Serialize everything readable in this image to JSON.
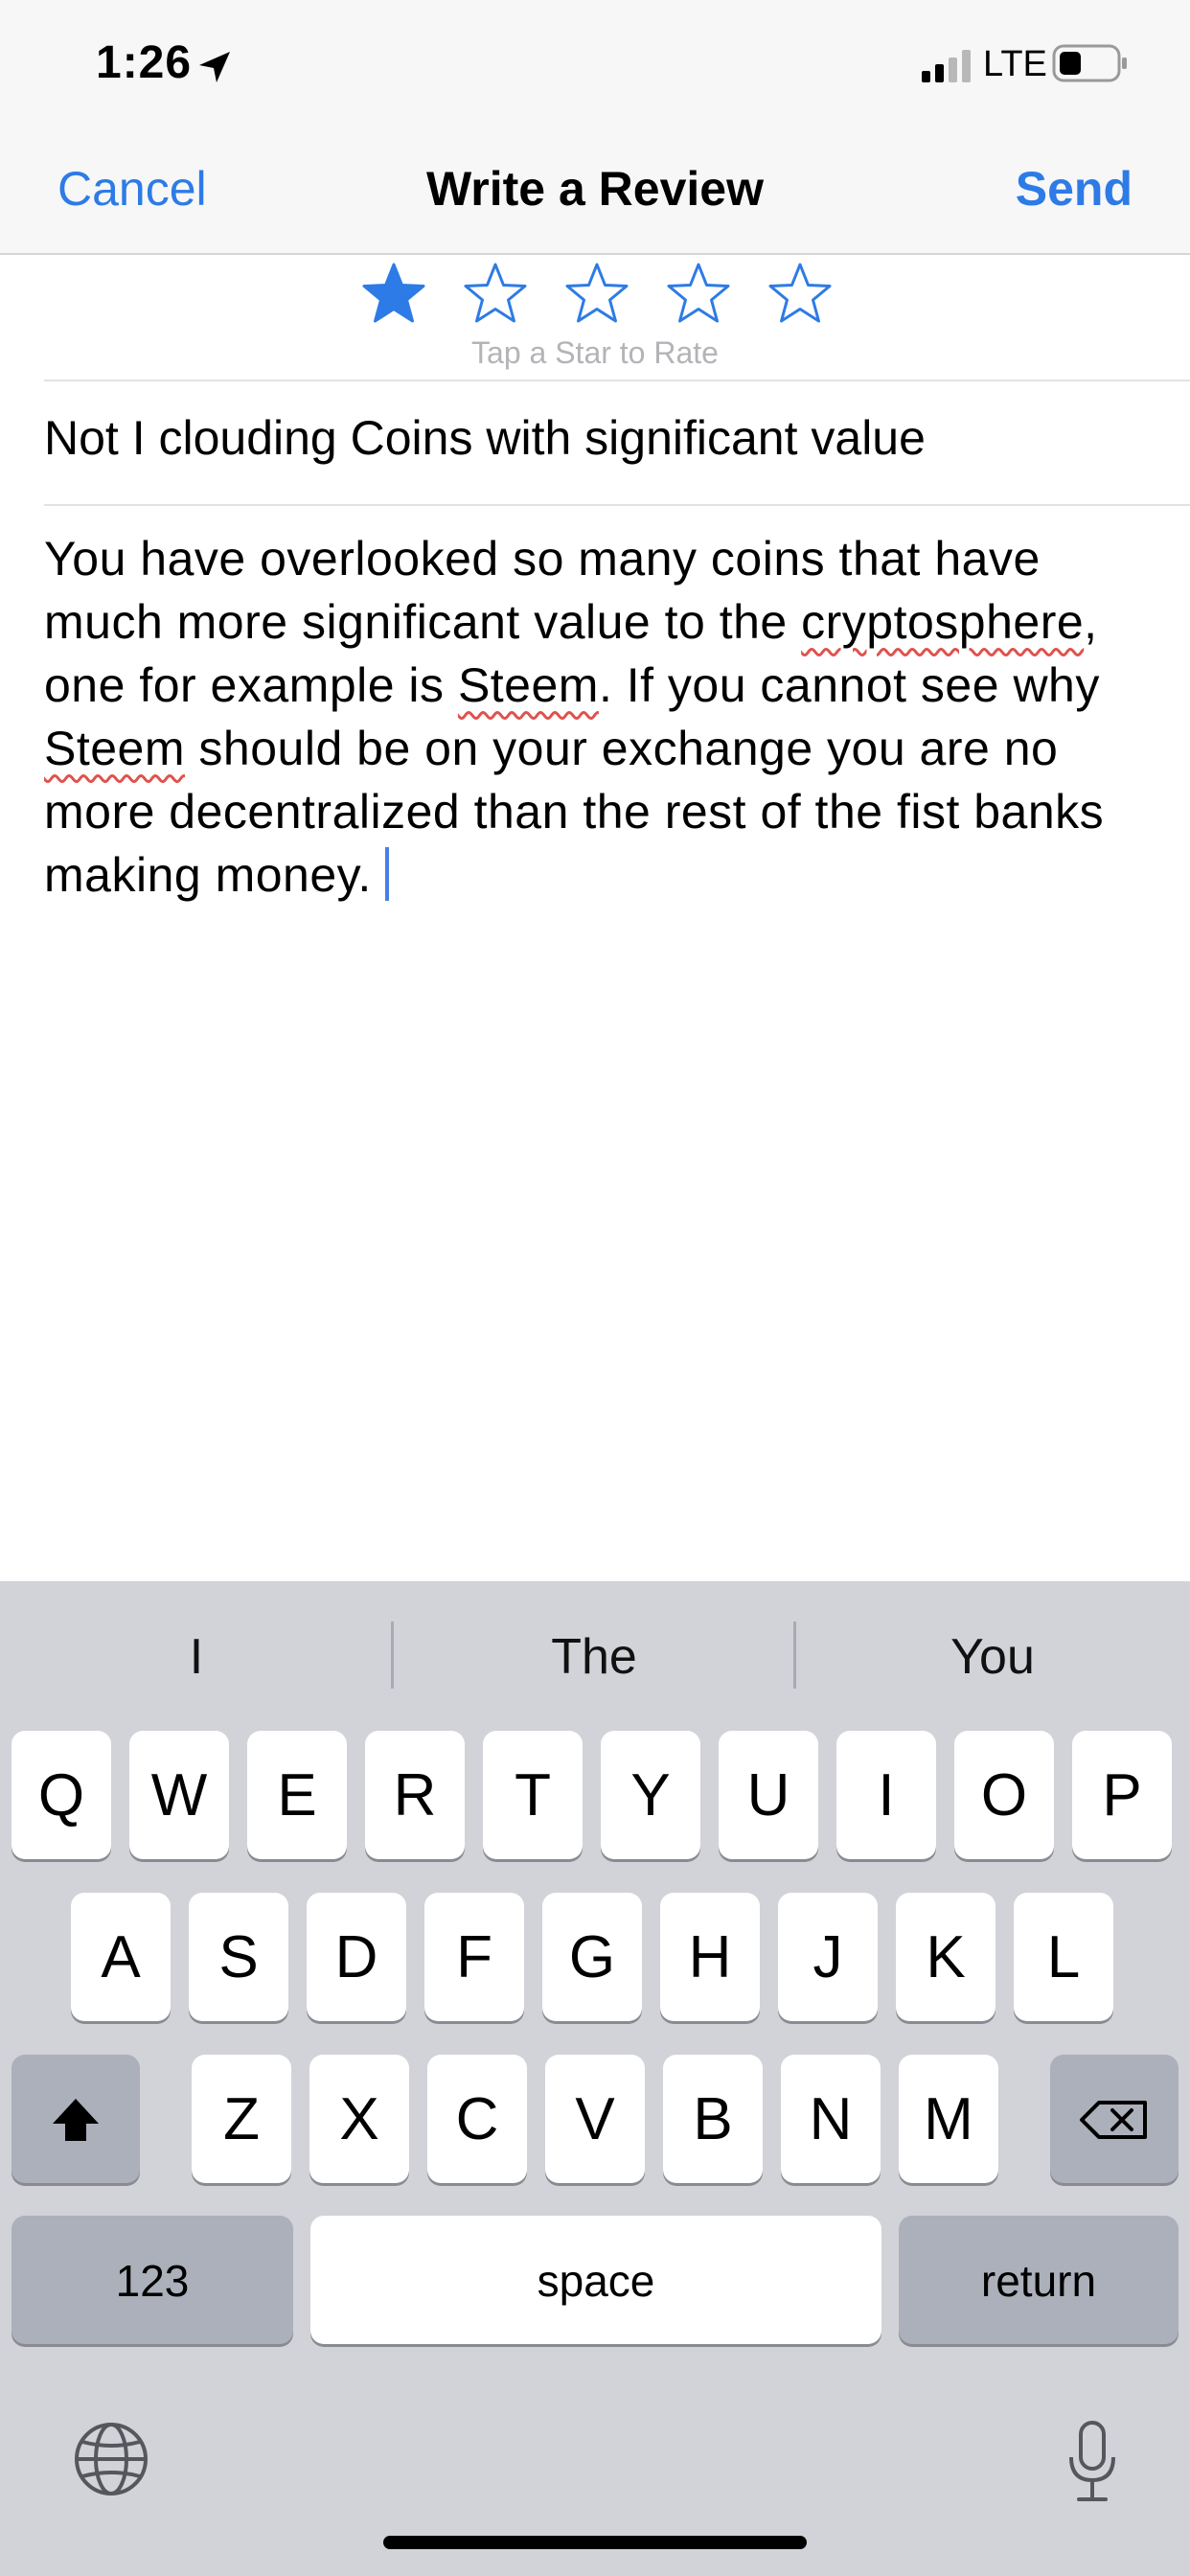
{
  "status_bar": {
    "time": "1:26",
    "network": "LTE"
  },
  "nav": {
    "cancel": "Cancel",
    "title": "Write a Review",
    "send": "Send"
  },
  "rating": {
    "value": 1,
    "max": 5,
    "hint": "Tap a Star to Rate",
    "color": "#2d7be6"
  },
  "review": {
    "title": "Not I clouding Coins with significant value",
    "body_parts": [
      "You have overlooked so many coins that have much more significant value to the ",
      "cryptosphere",
      ", one for example is ",
      "Steem",
      ". If you cannot see why ",
      "Steem",
      " should be on your exchange you are no more decentralized than the rest of the fist banks making money."
    ]
  },
  "keyboard": {
    "suggestions": [
      "I",
      "The",
      "You"
    ],
    "row1": [
      "Q",
      "W",
      "E",
      "R",
      "T",
      "Y",
      "U",
      "I",
      "O",
      "P"
    ],
    "row2": [
      "A",
      "S",
      "D",
      "F",
      "G",
      "H",
      "J",
      "K",
      "L"
    ],
    "row3": [
      "Z",
      "X",
      "C",
      "V",
      "B",
      "N",
      "M"
    ],
    "numbers_label": "123",
    "space_label": "space",
    "return_label": "return"
  }
}
